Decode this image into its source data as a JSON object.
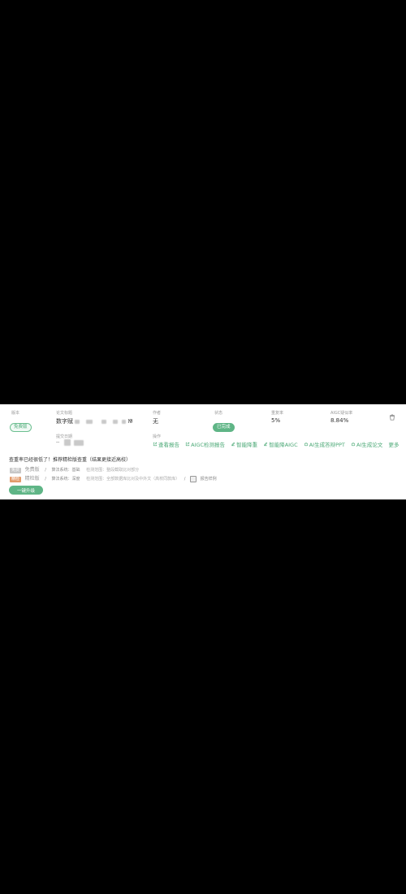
{
  "card": {
    "version_label": "版本",
    "version_tag": "免费版",
    "title_label": "论文标题",
    "title_value": "数字赋",
    "title_tail": "ᘠ",
    "advisor_label": "作者",
    "advisor_value": "无",
    "status_label": "状态",
    "status_tag": "已完成",
    "repeat_label": "重复率",
    "repeat_value": "5%",
    "aigc_label": "AIGC疑似率",
    "aigc_value": "8.84%",
    "date_label": "提交日期",
    "date_value": "--",
    "ops_label": "操作",
    "ops": [
      {
        "label": "查看报告",
        "icon": "external-link-icon"
      },
      {
        "label": "AIGC检测报告",
        "icon": "external-link-icon"
      },
      {
        "label": "智能降重",
        "icon": "edit-icon"
      },
      {
        "label": "智能降AIGC",
        "icon": "edit-icon"
      },
      {
        "label": "AI生成答辩PPT",
        "icon": "robot-icon"
      },
      {
        "label": "AI生成论文",
        "icon": "robot-icon"
      }
    ],
    "more_label": "更多",
    "promo_text": "查重率已经很低了！推荐精检版查重（结果更接近高校）",
    "free_row": {
      "chip": "免费",
      "name": "免费版",
      "sep": "/",
      "algo": "算法系统：基础",
      "scope": "检测范围：整段截取比对部分"
    },
    "precise_row": {
      "chip": "精检",
      "name": "精检版",
      "sep": "/",
      "algo": "算法系统：深度",
      "scope": "检测范围：全部数据库比对及中外文（高校同款库）",
      "extra": "报告样例"
    },
    "action_button": "一键升级"
  },
  "colors": {
    "accent": "#5fb586",
    "background": "#000000",
    "card": "#ffffff"
  }
}
